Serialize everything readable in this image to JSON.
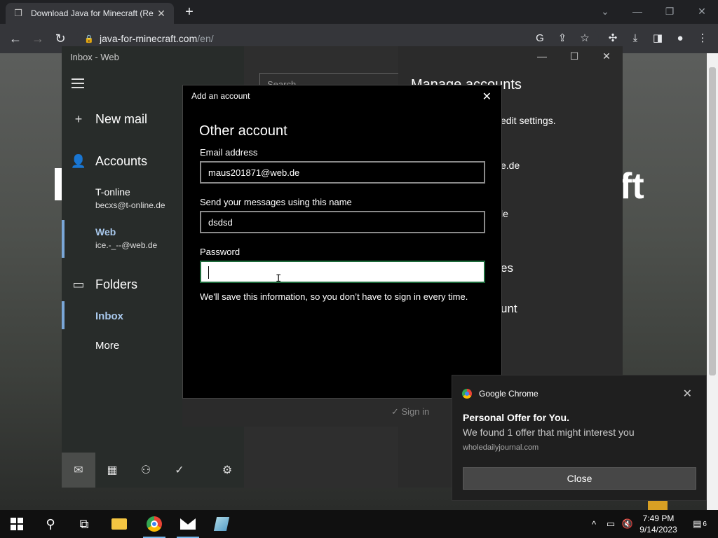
{
  "browser": {
    "tab_title": "Download Java for Minecraft (Re",
    "url_domain": "java-for-minecraft.com",
    "url_path": "/en/"
  },
  "page": {
    "bg_title_fragment": "ft"
  },
  "mail": {
    "window_title": "Inbox - Web",
    "new_mail": "New mail",
    "accounts_heading": "Accounts",
    "accounts": [
      {
        "name": "T-online",
        "email": "becxs@t-online.de"
      },
      {
        "name": "Web",
        "email": "ice.-_--@web.de"
      }
    ],
    "folders_heading": "Folders",
    "folders": [
      "Inbox",
      "More"
    ],
    "search_placeholder": "Search"
  },
  "manage": {
    "title": "Manage accounts",
    "line1": "edit settings.",
    "line2": "e.de",
    "line3": "le",
    "line4": "es",
    "line5": "unt"
  },
  "dialog": {
    "header": "Add an account",
    "title": "Other account",
    "email_label": "Email address",
    "email_value": "maus201871@web.de",
    "name_label": "Send your messages using this name",
    "name_value": "dsdsd",
    "password_label": "Password",
    "password_value": "",
    "note": "We'll save this information, so you don’t have to sign in every time.",
    "signin": "Sign in"
  },
  "notification": {
    "app": "Google Chrome",
    "title": "Personal Offer for You.",
    "body": "We found 1 offer that might interest you",
    "source": "wholedailyjournal.com",
    "button": "Close"
  },
  "taskbar": {
    "time": "7:49 PM",
    "date": "9/14/2023",
    "notif_count": "6"
  }
}
